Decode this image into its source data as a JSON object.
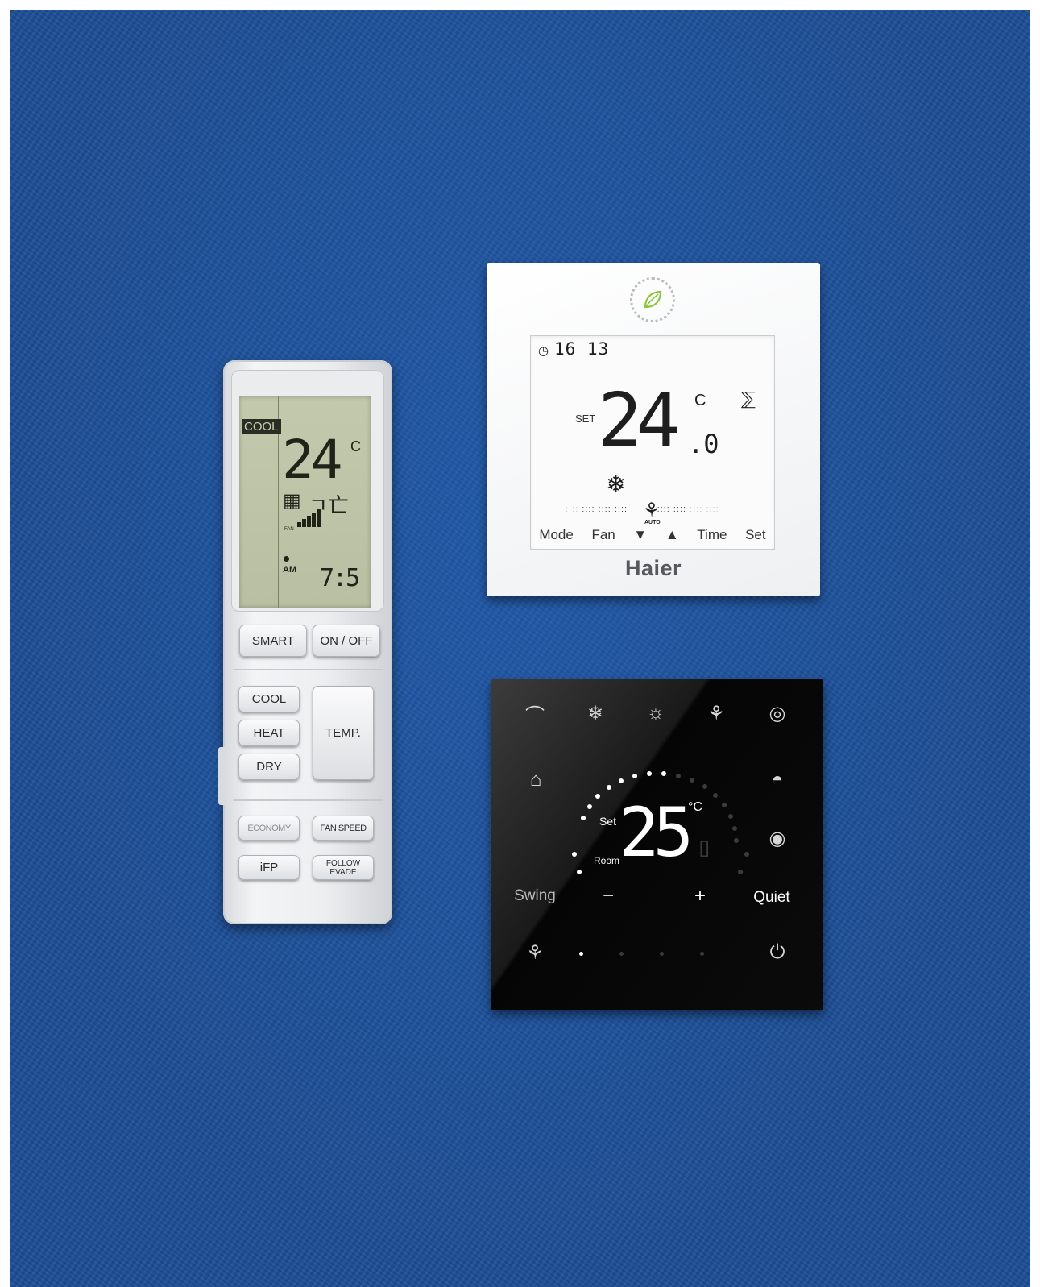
{
  "remote": {
    "lcd": {
      "mode": "COOL",
      "set_temp": "24",
      "unit": "C",
      "fan_label": "FAN",
      "fan_level": 5,
      "am_pm": "AM",
      "time": "7:5"
    },
    "buttons": {
      "smart": "SMART",
      "on_off": "ON / OFF",
      "cool": "COOL",
      "heat": "HEAT",
      "dry": "DRY",
      "temp": "TEMP.",
      "economy": "ECONOMY",
      "fan_speed": "FAN SPEED",
      "ifp": "iFP",
      "follow": "FOLLOW",
      "evade": "EVADE"
    }
  },
  "white_controller": {
    "clock": "16 13",
    "set_label": "SET",
    "set_temp": "24",
    "decimal": ".0",
    "unit": "C",
    "fan_mode": "AUTO",
    "softkeys": {
      "mode": "Mode",
      "fan": "Fan",
      "down": "▼",
      "up": "▲",
      "time": "Time",
      "set": "Set"
    },
    "brand": "Haier",
    "accent_leaf": "#8cc63f"
  },
  "black_controller": {
    "set_label": "Set",
    "room_label": "Room",
    "temperature": "25",
    "unit": "°C",
    "swing_label": "Swing",
    "minus_label": "−",
    "plus_label": "+",
    "quiet_label": "Quiet",
    "fan_level": 1,
    "icons": {
      "auto_mode": "auto-mode-icon",
      "cool": "snowflake-icon",
      "heat": "sun-icon",
      "fan": "fan-mode-icon",
      "dry": "drop-icon",
      "lock": "lock-icon",
      "sleep": "sleep-icon",
      "eco": "eco-icon",
      "fan_speed": "fan-icon",
      "power": "power-icon"
    }
  }
}
